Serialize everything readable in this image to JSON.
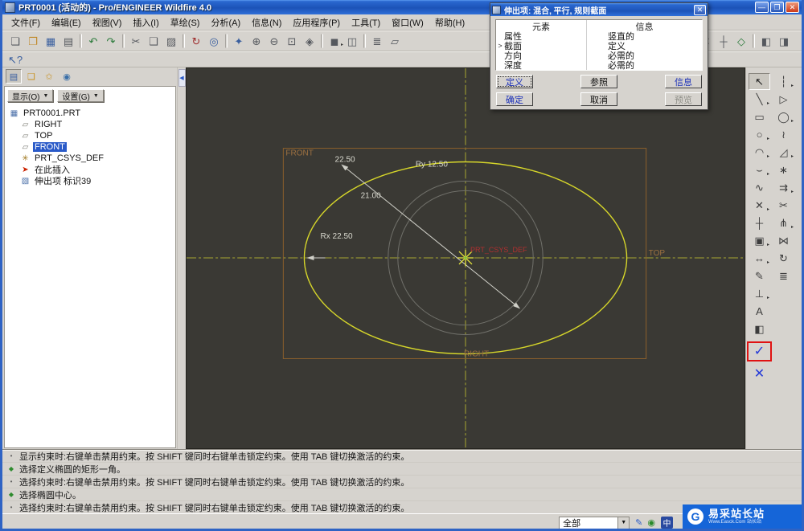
{
  "window": {
    "title": "PRT0001 (活动的) - Pro/ENGINEER Wildfire 4.0",
    "controls": [
      {
        "name": "minimize-button",
        "glyph": "—"
      },
      {
        "name": "maximize-button",
        "glyph": "❐"
      },
      {
        "name": "close-button",
        "glyph": "✕",
        "cls": "close"
      }
    ]
  },
  "menu": {
    "items": [
      {
        "name": "menu-file",
        "label": "文件(F)"
      },
      {
        "name": "menu-edit",
        "label": "编辑(E)"
      },
      {
        "name": "menu-view",
        "label": "视图(V)"
      },
      {
        "name": "menu-insert",
        "label": "插入(I)"
      },
      {
        "name": "menu-sketch",
        "label": "草绘(S)"
      },
      {
        "name": "menu-analysis",
        "label": "分析(A)"
      },
      {
        "name": "menu-info",
        "label": "信息(N)"
      },
      {
        "name": "menu-applications",
        "label": "应用程序(P)"
      },
      {
        "name": "menu-tools",
        "label": "工具(T)"
      },
      {
        "name": "menu-window",
        "label": "窗口(W)"
      },
      {
        "name": "menu-help",
        "label": "帮助(H)"
      }
    ]
  },
  "toolbar1": {
    "left": [
      {
        "name": "new-file-button",
        "glyph": "❏",
        "color": "#55585e"
      },
      {
        "name": "open-file-button",
        "glyph": "❐",
        "color": "#c08828"
      },
      {
        "name": "save-button",
        "glyph": "▦",
        "color": "#3a5f9f"
      },
      {
        "name": "print-button",
        "glyph": "▤",
        "color": "#55585e"
      },
      {
        "name": "toolbar-separator",
        "cls": "sep",
        "inter": "false"
      },
      {
        "name": "undo-button",
        "glyph": "↶",
        "color": "#2a7a3a"
      },
      {
        "name": "redo-button",
        "glyph": "↷",
        "color": "#2a7a3a"
      },
      {
        "name": "toolbar-separator",
        "cls": "sep",
        "inter": "false"
      },
      {
        "name": "cut-button",
        "glyph": "✂",
        "color": "#55585e"
      },
      {
        "name": "copy-button",
        "glyph": "❑",
        "color": "#55585e"
      },
      {
        "name": "paste-button",
        "glyph": "▨",
        "color": "#55585e"
      },
      {
        "name": "toolbar-separator",
        "cls": "sep",
        "inter": "false"
      },
      {
        "name": "regenerate-button",
        "glyph": "↻",
        "color": "#a03030"
      },
      {
        "name": "find-button",
        "glyph": "◎",
        "color": "#3a5f9f"
      },
      {
        "name": "toolbar-separator",
        "cls": "sep",
        "inter": "false"
      },
      {
        "name": "repaint-button",
        "glyph": "✦",
        "color": "#3a5f9f"
      },
      {
        "name": "zoom-in-button",
        "glyph": "⊕",
        "color": "#55585e"
      },
      {
        "name": "zoom-out-button",
        "glyph": "⊖",
        "color": "#55585e"
      },
      {
        "name": "refit-button",
        "glyph": "⊡",
        "color": "#55585e"
      },
      {
        "name": "reorient-button",
        "glyph": "◈",
        "color": "#55585e"
      },
      {
        "name": "toolbar-separator",
        "cls": "sep",
        "inter": "false"
      },
      {
        "name": "display-style-button",
        "glyph": "◼",
        "cls": "fly",
        "color": "#55585e"
      },
      {
        "name": "view-manager-button",
        "glyph": "◫",
        "color": "#55585e"
      },
      {
        "name": "toolbar-separator",
        "cls": "sep",
        "inter": "false"
      },
      {
        "name": "layers-button",
        "glyph": "≣",
        "color": "#55585e"
      },
      {
        "name": "annotations-button",
        "glyph": "▱",
        "color": "#55585e"
      }
    ],
    "right": [
      {
        "name": "datum-plane-toggle",
        "glyph": "▱",
        "color": "#8a6a2a"
      },
      {
        "name": "datum-axis-toggle",
        "glyph": "⁄",
        "color": "#8a4a2a"
      },
      {
        "name": "datum-point-toggle",
        "glyph": "✕",
        "color": "#55585e"
      },
      {
        "name": "csys-display-toggle",
        "glyph": "┼",
        "color": "#55585e"
      },
      {
        "name": "spin-center-toggle",
        "glyph": "◇",
        "color": "#2a7a3a"
      },
      {
        "name": "toolbar-separator",
        "cls": "sep",
        "inter": "false"
      },
      {
        "name": "new-window-button",
        "glyph": "◧",
        "color": "#55585e"
      },
      {
        "name": "close-window-button",
        "glyph": "◨",
        "color": "#55585e"
      }
    ]
  },
  "toolbar2": {
    "items": [
      {
        "name": "context-help-button",
        "glyph": "↖?",
        "color": "#3a5f9f"
      }
    ]
  },
  "navigator": {
    "tabs": [
      {
        "name": "model-tree-tab",
        "glyph": "▤",
        "color": "#3a5f9f",
        "cls": "pressed"
      },
      {
        "name": "folder-browser-tab",
        "glyph": "❑",
        "color": "#c89020"
      },
      {
        "name": "favorites-tab",
        "glyph": "✩",
        "color": "#c89020"
      },
      {
        "name": "history-tab",
        "glyph": "◉",
        "color": "#3a6fa8"
      }
    ],
    "show_button": "显示(O)",
    "settings_button": "设置(G)",
    "tree": [
      {
        "name": "tree-item-part-root",
        "icon_name": "part-icon",
        "glyph": "▦",
        "color": "#4a6fa8",
        "label": "PRT0001.PRT"
      },
      {
        "name": "tree-item-right-plane",
        "icon_name": "datum-plane-icon",
        "glyph": "▱",
        "color": "#7a7a72",
        "label": "RIGHT",
        "cls": "lvl1"
      },
      {
        "name": "tree-item-top-plane",
        "icon_name": "datum-plane-icon",
        "glyph": "▱",
        "color": "#7a7a72",
        "label": "TOP",
        "cls": "lvl1"
      },
      {
        "name": "tree-item-front-plane",
        "icon_name": "datum-plane-icon",
        "glyph": "▱",
        "color": "#7a7a72",
        "label": "FRONT",
        "cls": "lvl1 sel"
      },
      {
        "name": "tree-item-csys",
        "icon_name": "coordinate-system-icon",
        "glyph": "✳",
        "color": "#a07820",
        "label": "PRT_CSYS_DEF",
        "cls": "lvl1"
      },
      {
        "name": "tree-item-insert-here",
        "icon_name": "insert-here-arrow-icon",
        "glyph": "➤",
        "color": "#cc2200",
        "label": "在此插入",
        "cls": "lvl1"
      },
      {
        "name": "tree-item-protrusion",
        "icon_name": "protrusion-feature-icon",
        "glyph": "▧",
        "color": "#4a6fa8",
        "label": "伸出项 标识39",
        "cls": "lvl1"
      }
    ]
  },
  "dialog": {
    "title": "伸出项: 混合, 平行, 规则截面",
    "close_glyph": "✕",
    "columns": [
      "元素",
      "信息"
    ],
    "rows": [
      {
        "name": "element-row-attributes",
        "el": "属性",
        "info": "竖直的",
        "mark": ""
      },
      {
        "name": "element-row-section",
        "el": "截面",
        "info": "定义",
        "mark": ">",
        "cls": "cur"
      },
      {
        "name": "element-row-direction",
        "el": "方向",
        "info": "必需的",
        "mark": ""
      },
      {
        "name": "element-row-depth",
        "el": "深度",
        "info": "必需的",
        "mark": ""
      }
    ],
    "buttons": {
      "define": "定义",
      "refs": "参照",
      "info": "信息",
      "ok": "确定",
      "cancel": "取消",
      "preview": "预览"
    }
  },
  "canvas": {
    "plane_labels": {
      "front": "FRONT",
      "top": "TOP",
      "right": "RIGHT"
    },
    "csys_label": "PRT_CSYS_DEF",
    "dims": {
      "d_major": "22.50",
      "d_minor": "21.00",
      "rx": "Rx 22.50",
      "ry": "Ry 12.50"
    }
  },
  "right_toolbar": {
    "col1": [
      {
        "name": "select-tool",
        "glyph": "↖",
        "cls": "pressed",
        "color": "#1a1a1a"
      },
      {
        "name": "line-tool",
        "glyph": "╲",
        "cls": "fly"
      },
      {
        "name": "rectangle-tool",
        "glyph": "▭"
      },
      {
        "name": "circle-tool",
        "glyph": "○",
        "cls": "fly"
      },
      {
        "name": "arc-tool",
        "glyph": "◠",
        "cls": "fly"
      },
      {
        "name": "fillet-tool",
        "glyph": "⌣",
        "cls": "fly"
      },
      {
        "name": "spline-tool",
        "glyph": "∿"
      },
      {
        "name": "point-tool",
        "glyph": "✕",
        "cls": "fly"
      },
      {
        "name": "coordinate-system-tool",
        "glyph": "┼"
      },
      {
        "name": "use-edge-tool",
        "glyph": "▣",
        "cls": "fly"
      },
      {
        "name": "dimension-tool",
        "glyph": "↔",
        "cls": "fly"
      },
      {
        "name": "modify-dimension-tool",
        "glyph": "✎"
      },
      {
        "name": "constraint-tool",
        "glyph": "⊥",
        "cls": "fly"
      },
      {
        "name": "text-tool",
        "glyph": "A"
      },
      {
        "name": "palette-tool",
        "glyph": "◧"
      },
      {
        "name": "sketch-done-button",
        "glyph": "✓",
        "cls": "accept red-boxed",
        "color": "#2238d8"
      },
      {
        "name": "sketch-quit-button",
        "glyph": "✕",
        "cls": "accept",
        "color": "#2238d8"
      }
    ],
    "col2": [
      {
        "name": "centerline-tool",
        "glyph": "┆",
        "cls": "fly"
      },
      {
        "name": "axis-point-tool",
        "glyph": "▷"
      },
      {
        "name": "ellipse-tool",
        "glyph": "◯",
        "cls": "fly"
      },
      {
        "name": "conic-arc-tool",
        "glyph": "≀"
      },
      {
        "name": "chamfer-tool",
        "glyph": "◿",
        "cls": "fly"
      },
      {
        "name": "sketch-point-tool",
        "glyph": "∗"
      },
      {
        "name": "offset-tool",
        "glyph": "⇉",
        "cls": "fly"
      },
      {
        "name": "trim-delete-tool",
        "glyph": "✂"
      },
      {
        "name": "divide-tool",
        "glyph": "⋔",
        "cls": "fly"
      },
      {
        "name": "mirror-tool",
        "glyph": "⋈"
      },
      {
        "name": "rotate-resize-tool",
        "glyph": "↻"
      },
      {
        "name": "thicken-tool",
        "glyph": "≣"
      }
    ]
  },
  "messages": {
    "lines": [
      {
        "name": "message-line",
        "glyph": "•",
        "color": "#606060",
        "text": "显示约束时:右键单击禁用约束。按 SHIFT 键同时右键单击锁定约束。使用 TAB 键切换激活的约束。"
      },
      {
        "name": "prompt-line",
        "glyph": "◆",
        "color": "#2e8b2e",
        "text": "选择定义椭圆的矩形一角。"
      },
      {
        "name": "message-line",
        "glyph": "•",
        "color": "#606060",
        "text": "选择约束时:右键单击禁用约束。按 SHIFT 键同时右键单击锁定约束。使用 TAB 键切换激活的约束。"
      },
      {
        "name": "prompt-line",
        "glyph": "◆",
        "color": "#2e8b2e",
        "text": "选择椭圆中心。"
      },
      {
        "name": "message-line",
        "glyph": "•",
        "color": "#606060",
        "text": "选择约束时:右键单击禁用约束。按 SHIFT 键同时右键单击锁定约束。使用 TAB 键切换激活的约束。"
      }
    ]
  },
  "statusbar": {
    "filter_value": "全部",
    "icons": [
      {
        "name": "regen-status-icon",
        "glyph": "✎",
        "color": "#2a5ac8"
      },
      {
        "name": "web-status-icon",
        "glyph": "◉",
        "color": "#2a8a2a"
      }
    ],
    "ime_badge": "中"
  },
  "watermark": {
    "logo_glyph": "G",
    "title": "易采站长站",
    "subtitle": "Www.Easck.Com 站长站"
  }
}
